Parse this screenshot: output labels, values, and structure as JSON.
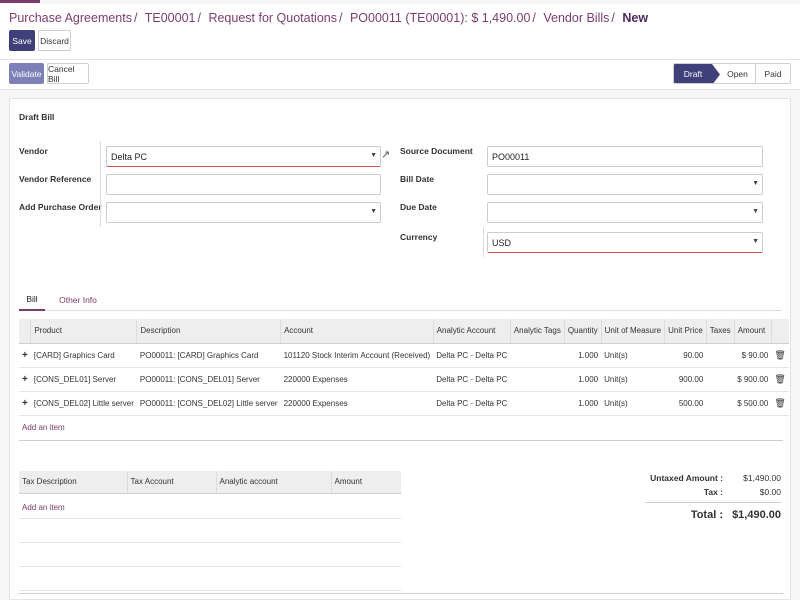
{
  "breadcrumb": {
    "items": [
      "Purchase Agreements",
      "TE00001",
      "Request for Quotations",
      "PO00011 (TE00001): $ 1,490.00",
      "Vendor Bills"
    ],
    "current": "New"
  },
  "actions": {
    "save": "Save",
    "discard": "Discard",
    "validate": "Validate",
    "cancel_bill": "Cancel Bill"
  },
  "status": {
    "stages": [
      "Draft",
      "Open",
      "Paid"
    ],
    "current": "Draft"
  },
  "form": {
    "title": "Draft Bill",
    "vendor": {
      "label": "Vendor",
      "value": "Delta PC"
    },
    "vendor_reference": {
      "label": "Vendor Reference",
      "value": ""
    },
    "add_purchase_order": {
      "label": "Add Purchase Order",
      "value": ""
    },
    "source_document": {
      "label": "Source Document",
      "value": "PO00011"
    },
    "bill_date": {
      "label": "Bill Date",
      "value": ""
    },
    "due_date": {
      "label": "Due Date",
      "value": ""
    },
    "currency": {
      "label": "Currency",
      "value": "USD"
    }
  },
  "tabs": [
    "Bill",
    "Other Info"
  ],
  "lines": {
    "columns": [
      "Product",
      "Description",
      "Account",
      "Analytic Account",
      "Analytic Tags",
      "Quantity",
      "Unit of Measure",
      "Unit Price",
      "Taxes",
      "Amount"
    ],
    "rows": [
      {
        "product": "[CARD] Graphics Card",
        "description": "PO00011: [CARD] Graphics Card",
        "account": "101120 Stock Interim Account (Received)",
        "analytic": "Delta PC - Delta PC",
        "tags": "",
        "qty": "1.000",
        "uom": "Unit(s)",
        "price": "90.00",
        "taxes": "",
        "amount": "$ 90.00"
      },
      {
        "product": "[CONS_DEL01] Server",
        "description": "PO00011: [CONS_DEL01] Server",
        "account": "220000 Expenses",
        "analytic": "Delta PC - Delta PC",
        "tags": "",
        "qty": "1.000",
        "uom": "Unit(s)",
        "price": "900.00",
        "taxes": "",
        "amount": "$ 900.00"
      },
      {
        "product": "[CONS_DEL02] Little server",
        "description": "PO00011: [CONS_DEL02] Little server",
        "account": "220000 Expenses",
        "analytic": "Delta PC - Delta PC",
        "tags": "",
        "qty": "1.000",
        "uom": "Unit(s)",
        "price": "500.00",
        "taxes": "",
        "amount": "$ 500.00"
      }
    ],
    "add_item": "Add an item"
  },
  "tax_lines": {
    "columns": [
      "Tax Description",
      "Tax Account",
      "Analytic account",
      "Amount"
    ],
    "add_item": "Add an item"
  },
  "totals": {
    "untaxed_label": "Untaxed Amount :",
    "untaxed_value": "$1,490.00",
    "tax_label": "Tax :",
    "tax_value": "$0.00",
    "total_label": "Total :",
    "total_value": "$1,490.00"
  },
  "icons": {
    "dropdown": "caret-down-icon",
    "external": "external-link-icon",
    "drag": "plus-handle-icon",
    "delete": "trash-icon"
  },
  "colors": {
    "brand": "#7c3d6e",
    "primary_button": "#3f3f79",
    "validate_button": "#7d80b7",
    "required_border": "#d84f4f"
  }
}
